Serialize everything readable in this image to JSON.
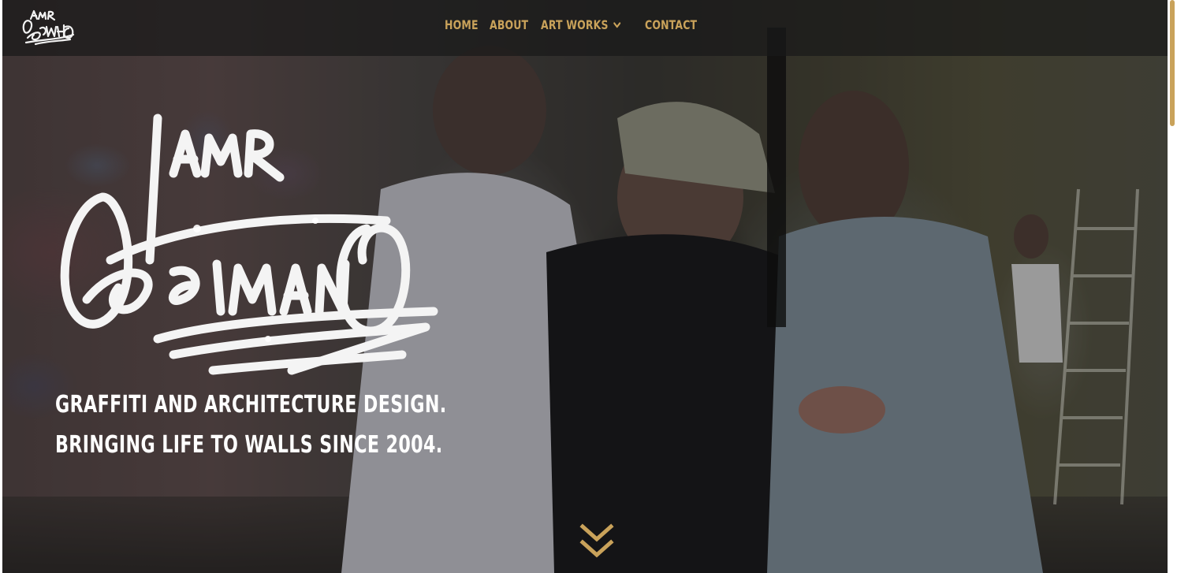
{
  "brand": {
    "logo_alt": "Amr Osmanio graffiti tag logo"
  },
  "nav": {
    "items": [
      {
        "label": "HOME"
      },
      {
        "label": "ABOUT"
      },
      {
        "label": "ART WORKS",
        "has_dropdown": true
      },
      {
        "label": "CONTACT"
      }
    ]
  },
  "hero": {
    "tagline_line1": "GRAFFITI AND ARCHITECTURE DESIGN.",
    "tagline_line2": "BRINGING LIFE TO WALLS SINCE 2004.",
    "scroll_icon": "double-chevron-down-icon"
  },
  "colors": {
    "accent": "#c9a25a",
    "nav_bg": "#191919",
    "text": "#ffffff"
  }
}
